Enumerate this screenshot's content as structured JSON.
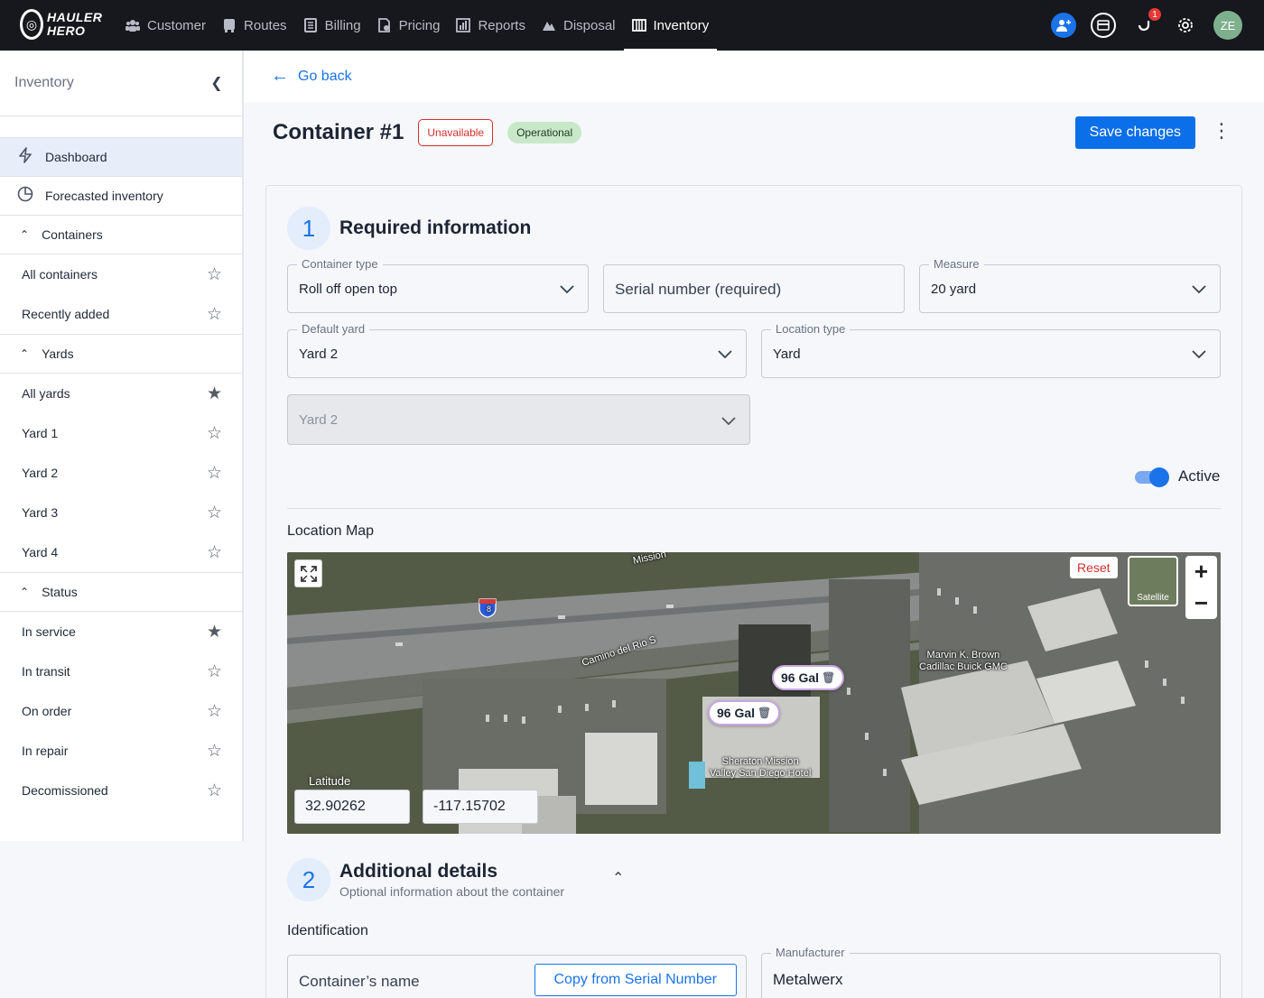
{
  "brand": {
    "logo_line1": "HAULER",
    "logo_line2": "HERO"
  },
  "nav": {
    "items": [
      {
        "label": "Customer",
        "icon": "users-icon"
      },
      {
        "label": "Routes",
        "icon": "truck-icon"
      },
      {
        "label": "Billing",
        "icon": "billing-icon"
      },
      {
        "label": "Pricing",
        "icon": "pricing-icon"
      },
      {
        "label": "Reports",
        "icon": "reports-icon"
      },
      {
        "label": "Disposal",
        "icon": "disposal-icon"
      },
      {
        "label": "Inventory",
        "icon": "inventory-icon",
        "active": true
      }
    ],
    "notification_count": "1",
    "avatar_initials": "ZE"
  },
  "sidebar": {
    "title": "Inventory",
    "top_items": [
      {
        "label": "Dashboard",
        "icon": "lightning-icon",
        "active": true
      },
      {
        "label": "Forecasted inventory",
        "icon": "pie-chart-icon"
      }
    ],
    "sections": [
      {
        "label": "Containers",
        "items": [
          {
            "label": "All containers",
            "starred": false
          },
          {
            "label": "Recently added",
            "starred": false
          }
        ]
      },
      {
        "label": "Yards",
        "items": [
          {
            "label": "All yards",
            "starred": true
          },
          {
            "label": "Yard 1",
            "starred": false
          },
          {
            "label": "Yard 2",
            "starred": false
          },
          {
            "label": "Yard 3",
            "starred": false
          },
          {
            "label": "Yard 4",
            "starred": false
          }
        ]
      },
      {
        "label": "Status",
        "items": [
          {
            "label": "In service",
            "starred": true
          },
          {
            "label": "In transit",
            "starred": false
          },
          {
            "label": "On order",
            "starred": false
          },
          {
            "label": "In repair",
            "starred": false
          },
          {
            "label": "Decomissioned",
            "starred": false
          }
        ]
      }
    ]
  },
  "page": {
    "go_back": "Go back",
    "title": "Container #1",
    "status_tag": "Unavailable",
    "condition_tag": "Operational",
    "save_label": "Save changes"
  },
  "required": {
    "number": "1",
    "title": "Required information",
    "container_type": {
      "label": "Container type",
      "value": "Roll off open top"
    },
    "serial_number": {
      "placeholder": "Serial number (required)"
    },
    "measure": {
      "label": "Measure",
      "value": "20 yard"
    },
    "default_yard": {
      "label": "Default yard",
      "value": "Yard 2"
    },
    "location_type": {
      "label": "Location type",
      "value": "Yard"
    },
    "location": {
      "value": "Yard 2"
    },
    "active": {
      "label": "Active",
      "on": true
    }
  },
  "map": {
    "title": "Location Map",
    "reset_label": "Reset",
    "layer_label": "Satellite",
    "markers": [
      {
        "label": "96 Gal"
      },
      {
        "label": "96 Gal"
      }
    ],
    "labels": {
      "road1": "Mission",
      "road2": "Camino del Rio S",
      "poi1": "Marvin K. Brown\nCadillac Buick GMC",
      "poi2": "Sheraton Mission\nValley San Diego Hotel",
      "highway": "8"
    },
    "latitude_label": "Latitude",
    "latitude": "32.90262",
    "longitude": "-117.15702"
  },
  "additional": {
    "number": "2",
    "title": "Additional details",
    "subtitle": "Optional information about the container",
    "identification": "Identification",
    "container_name": {
      "placeholder": "Container’s name"
    },
    "copy_label": "Copy from Serial Number",
    "manufacturer": {
      "label": "Manufacturer",
      "value": "Metalwerx"
    }
  }
}
